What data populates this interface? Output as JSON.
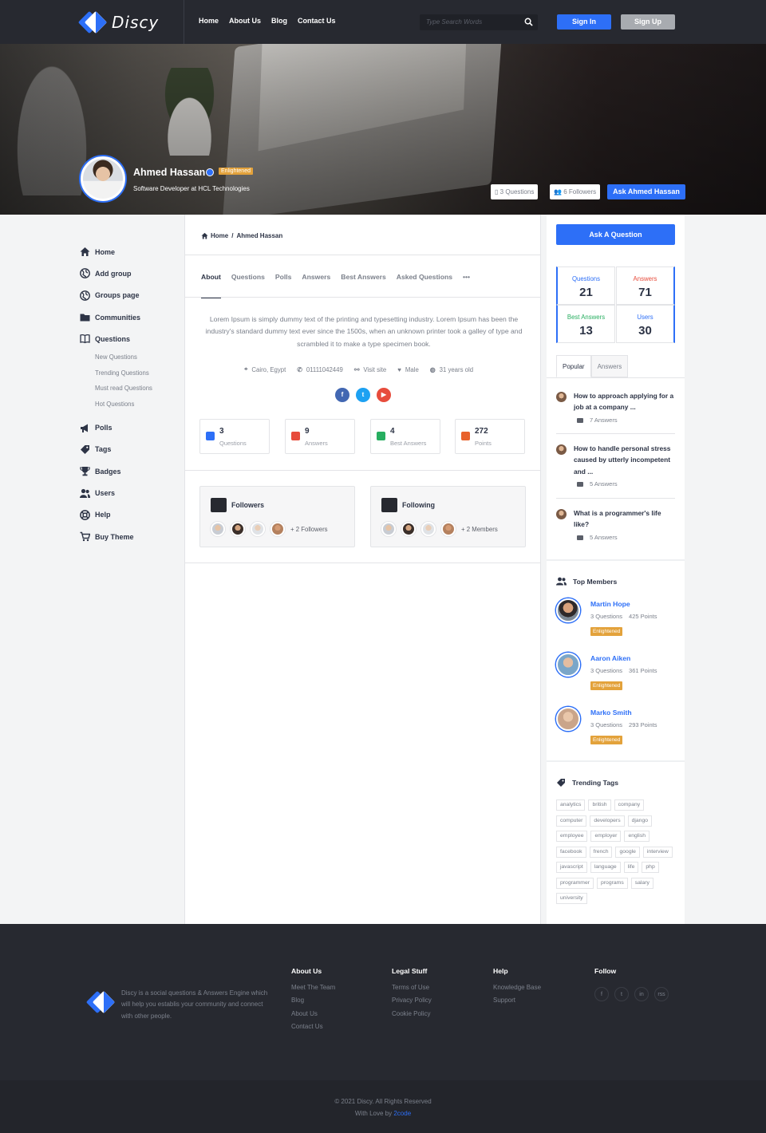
{
  "brand": {
    "name": "Discy",
    "primary": "#2d6ff7",
    "dark": "#272930",
    "badge": "#e3a23b"
  },
  "nav": {
    "items": [
      "Home",
      "About Us",
      "Blog",
      "Contact Us"
    ]
  },
  "search": {
    "placeholder": "Type Search Words"
  },
  "auth": {
    "sign_in": "Sign In",
    "sign_up": "Sign Up"
  },
  "profile": {
    "name": "Ahmed Hassan",
    "badge": "Enlightened",
    "job": "Software Developer at HCL Technologies",
    "questions_chip": "3 Questions",
    "followers_chip": "6 Followers",
    "ask_button": "Ask Ahmed Hassan"
  },
  "sidebar": {
    "items": [
      {
        "label": "Home",
        "icon": "home-icon"
      },
      {
        "label": "Add group",
        "icon": "globe-icon"
      },
      {
        "label": "Groups page",
        "icon": "globe-icon"
      },
      {
        "label": "Communities",
        "icon": "folder-icon"
      },
      {
        "label": "Questions",
        "icon": "book-icon"
      }
    ],
    "sub_items": [
      "New Questions",
      "Trending Questions",
      "Must read Questions",
      "Hot Questions"
    ],
    "items2": [
      {
        "label": "Polls",
        "icon": "megaphone-icon"
      },
      {
        "label": "Tags",
        "icon": "tag-icon"
      },
      {
        "label": "Badges",
        "icon": "trophy-icon"
      },
      {
        "label": "Users",
        "icon": "users-icon"
      },
      {
        "label": "Help",
        "icon": "lifebuoy-icon"
      },
      {
        "label": "Buy Theme",
        "icon": "cart-icon"
      }
    ]
  },
  "breadcrumb": {
    "home": "Home",
    "sep": "/",
    "current": "Ahmed Hassan"
  },
  "tabs": [
    "About",
    "Questions",
    "Polls",
    "Answers",
    "Best Answers",
    "Asked Questions",
    "•••"
  ],
  "about": {
    "text": "Lorem Ipsum is simply dummy text of the printing and typesetting industry. Lorem Ipsum has been the industry's standard dummy text ever since the 1500s, when an unknown printer took a galley of type and scrambled it to make a type specimen book.",
    "location": "Cairo, Egypt",
    "phone": "01111042449",
    "site": "Visit site",
    "gender": "Male",
    "age": "31 years old",
    "socials": [
      {
        "label": "f",
        "color": "#4267b2"
      },
      {
        "label": "t",
        "color": "#1da1f2"
      },
      {
        "label": "▶",
        "color": "#e74c3c"
      }
    ]
  },
  "stats": [
    {
      "num": "3",
      "label": "Questions",
      "color": "#2d6ff7"
    },
    {
      "num": "9",
      "label": "Answers",
      "color": "#e74c3c"
    },
    {
      "num": "4",
      "label": "Best Answers",
      "color": "#27ae60"
    },
    {
      "num": "272",
      "label": "Points",
      "color": "#e8622c"
    }
  ],
  "followers": {
    "title": "Followers",
    "more": "+ 2 Followers"
  },
  "following": {
    "title": "Following",
    "more": "+ 2 Members"
  },
  "right": {
    "ask_question": "Ask A Question",
    "stats": [
      {
        "label": "Questions",
        "value": "21",
        "color": "#2d6ff7"
      },
      {
        "label": "Answers",
        "value": "71",
        "color": "#e74c3c"
      },
      {
        "label": "Best Answers",
        "value": "13",
        "color": "#27ae60"
      },
      {
        "label": "Users",
        "value": "30",
        "color": "#2d6ff7"
      }
    ],
    "tabs": [
      "Popular",
      "Answers"
    ],
    "popular": [
      {
        "title": "How to approach applying for a job at a company ...",
        "answers": "7 Answers"
      },
      {
        "title": "How to handle personal stress caused by utterly incompetent and ...",
        "answers": "5 Answers"
      },
      {
        "title": "What is a programmer's life like?",
        "answers": "5 Answers"
      }
    ],
    "top_members_title": "Top Members",
    "members": [
      {
        "name": "Martin Hope",
        "questions": "3 Questions",
        "points": "425 Points",
        "badge": "Enlightened"
      },
      {
        "name": "Aaron Aiken",
        "questions": "3 Questions",
        "points": "361 Points",
        "badge": "Enlightened"
      },
      {
        "name": "Marko Smith",
        "questions": "3 Questions",
        "points": "293 Points",
        "badge": "Enlightened"
      }
    ],
    "trending_title": "Trending Tags",
    "tags": [
      "analytics",
      "british",
      "company",
      "computer",
      "developers",
      "django",
      "employee",
      "employer",
      "english",
      "facebook",
      "french",
      "google",
      "interview",
      "javascript",
      "language",
      "life",
      "php",
      "programmer",
      "programs",
      "salary",
      "university"
    ]
  },
  "footer": {
    "about": "Discy is a social questions & Answers Engine which will help you establis your community and connect with other people.",
    "cols": [
      {
        "title": "About Us",
        "links": [
          "Meet The Team",
          "Blog",
          "About Us",
          "Contact Us"
        ]
      },
      {
        "title": "Legal Stuff",
        "links": [
          "Terms of Use",
          "Privacy Policy",
          "Cookie Policy"
        ]
      },
      {
        "title": "Help",
        "links": [
          "Knowledge Base",
          "Support"
        ]
      },
      {
        "title": "Follow",
        "links": []
      }
    ],
    "socials": [
      "f",
      "t",
      "in",
      "rss"
    ],
    "copyright": "© 2021 Discy. All Rights Reserved",
    "love": "With Love by",
    "love_link": "2code"
  }
}
